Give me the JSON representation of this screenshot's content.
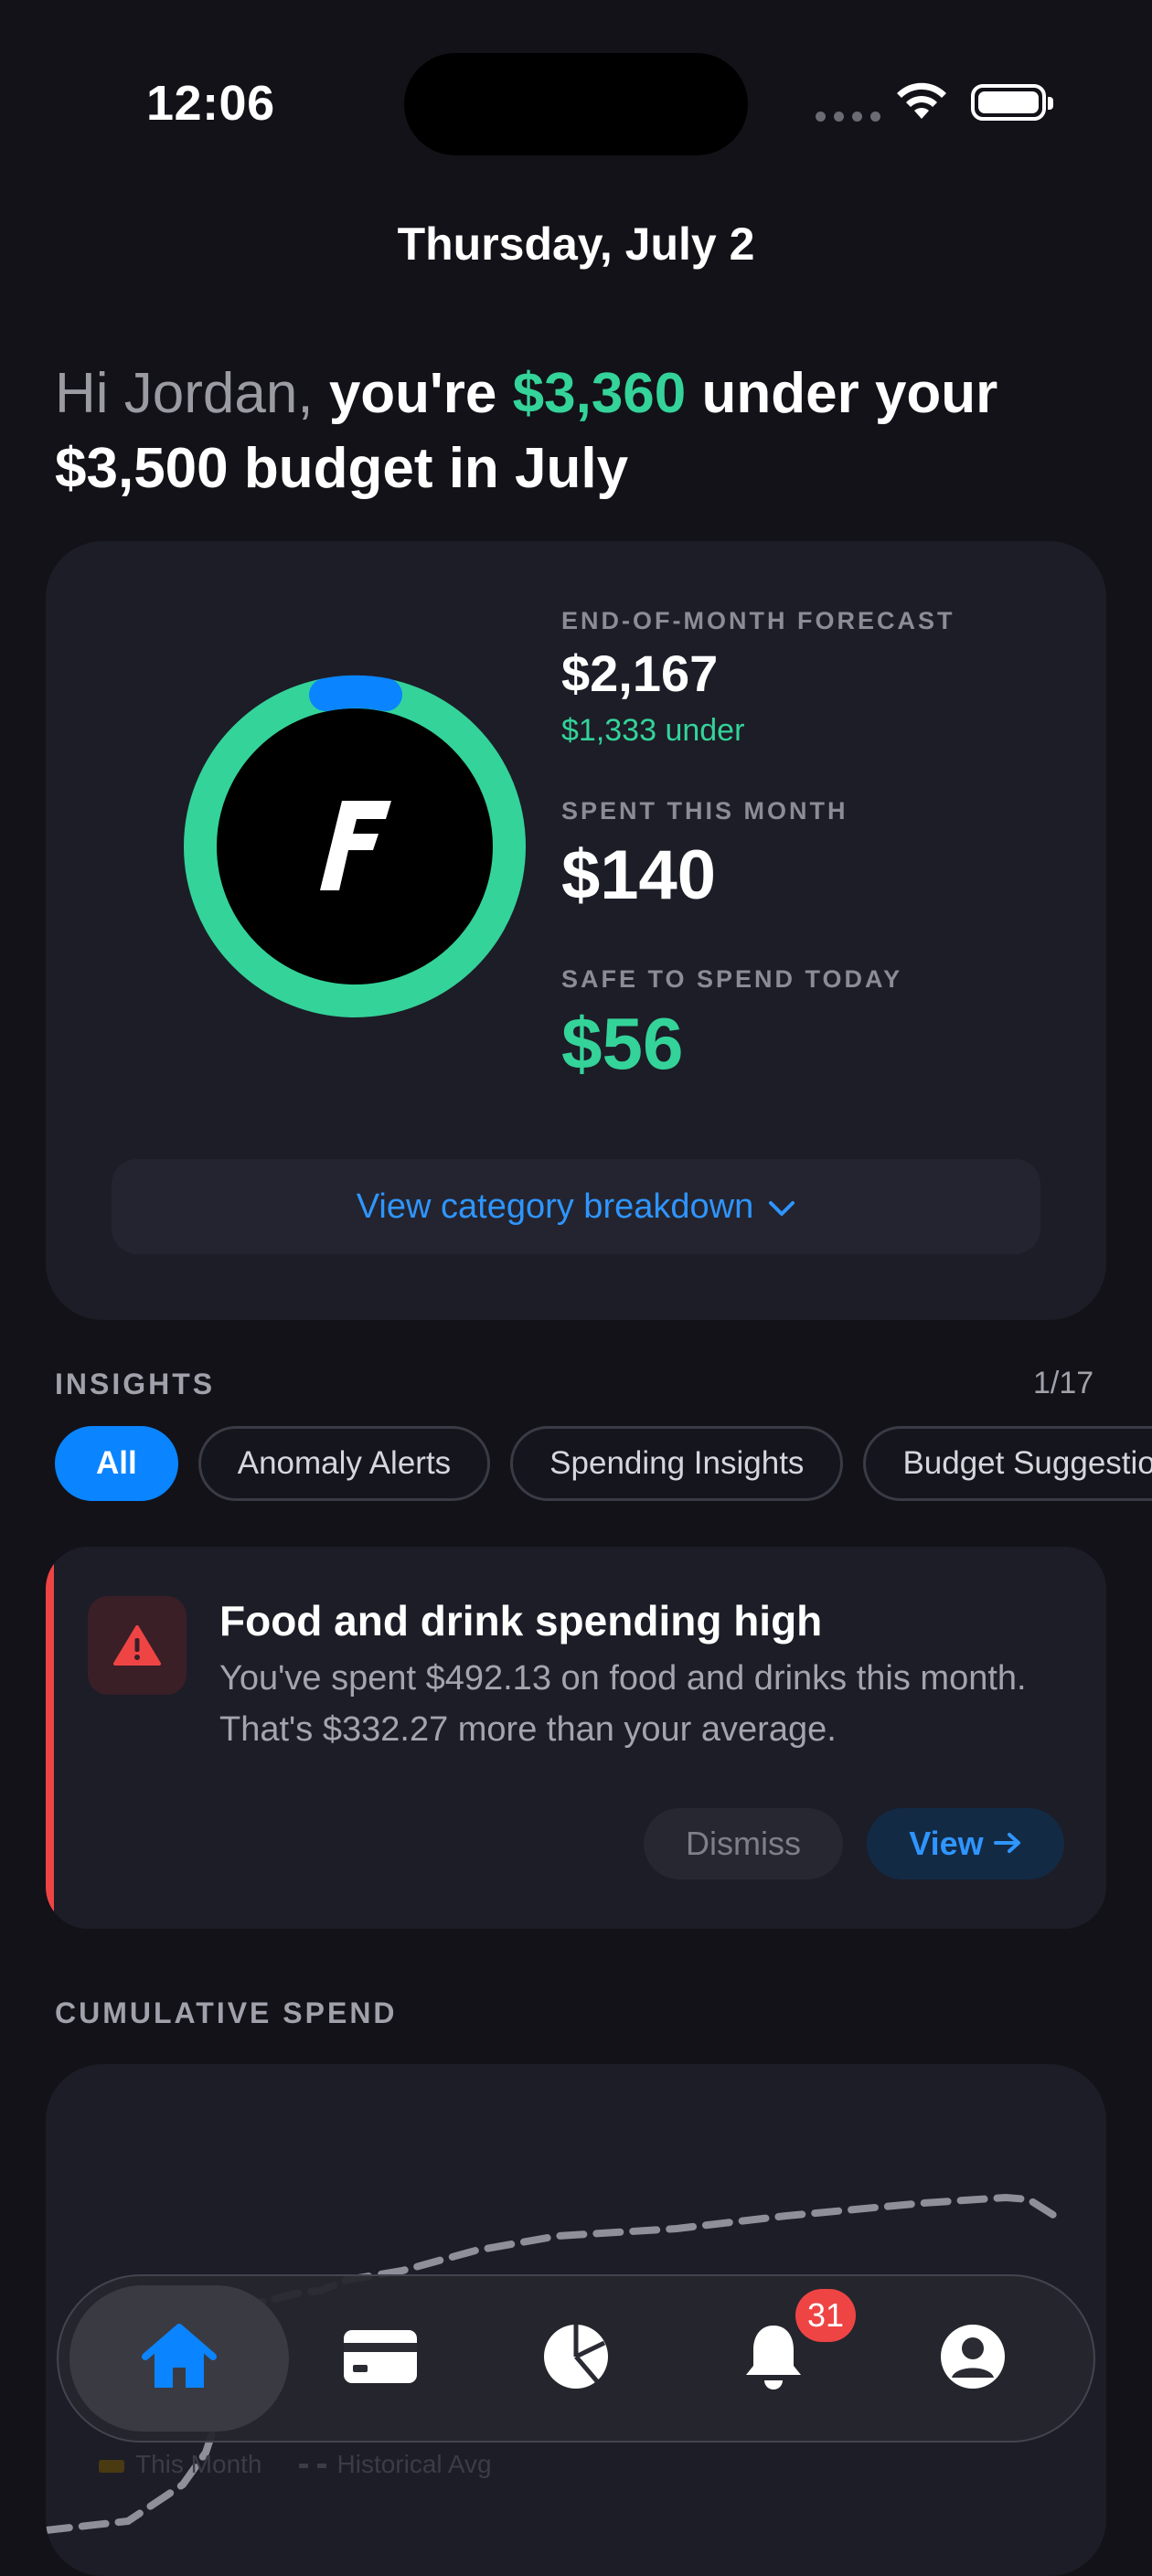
{
  "status_bar": {
    "time": "12:06"
  },
  "date": "Thursday, July 2",
  "greeting": {
    "prefix": "Hi Jordan,",
    "part1": "you're",
    "amount_under": "$3,360",
    "part2": "under your",
    "line2": "$3,500 budget in July"
  },
  "budget_card": {
    "logo_letter": "F",
    "forecast_label": "END-OF-MONTH FORECAST",
    "forecast_value": "$2,167",
    "forecast_sub": "$1,333 under",
    "spent_label": "SPENT THIS MONTH",
    "spent_value": "$140",
    "safe_label": "SAFE TO SPEND TODAY",
    "safe_value": "$56",
    "breakdown_label": "View category breakdown",
    "ring_colors": {
      "track": "#34d399",
      "progress": "#0a84ff"
    }
  },
  "insights": {
    "title": "INSIGHTS",
    "count": "1/17",
    "chips": [
      "All",
      "Anomaly Alerts",
      "Spending Insights",
      "Budget Suggestions"
    ],
    "alert": {
      "icon": "warning-icon",
      "title": "Food and drink spending high",
      "body": "You've spent $492.13 on food and drinks this month. That's $332.27 more than your average.",
      "dismiss_label": "Dismiss",
      "view_label": "View"
    }
  },
  "cumulative": {
    "title": "CUMULATIVE SPEND",
    "legend": [
      "This Month",
      "Historical Avg"
    ]
  },
  "tab_bar": {
    "tabs": [
      "home-icon",
      "card-icon",
      "pie-chart-icon",
      "bell-icon",
      "profile-icon"
    ],
    "notification_badge": "31"
  },
  "colors": {
    "accent": "#0a84ff",
    "positive": "#34d399",
    "alert": "#ef4444",
    "background": "#121218"
  }
}
